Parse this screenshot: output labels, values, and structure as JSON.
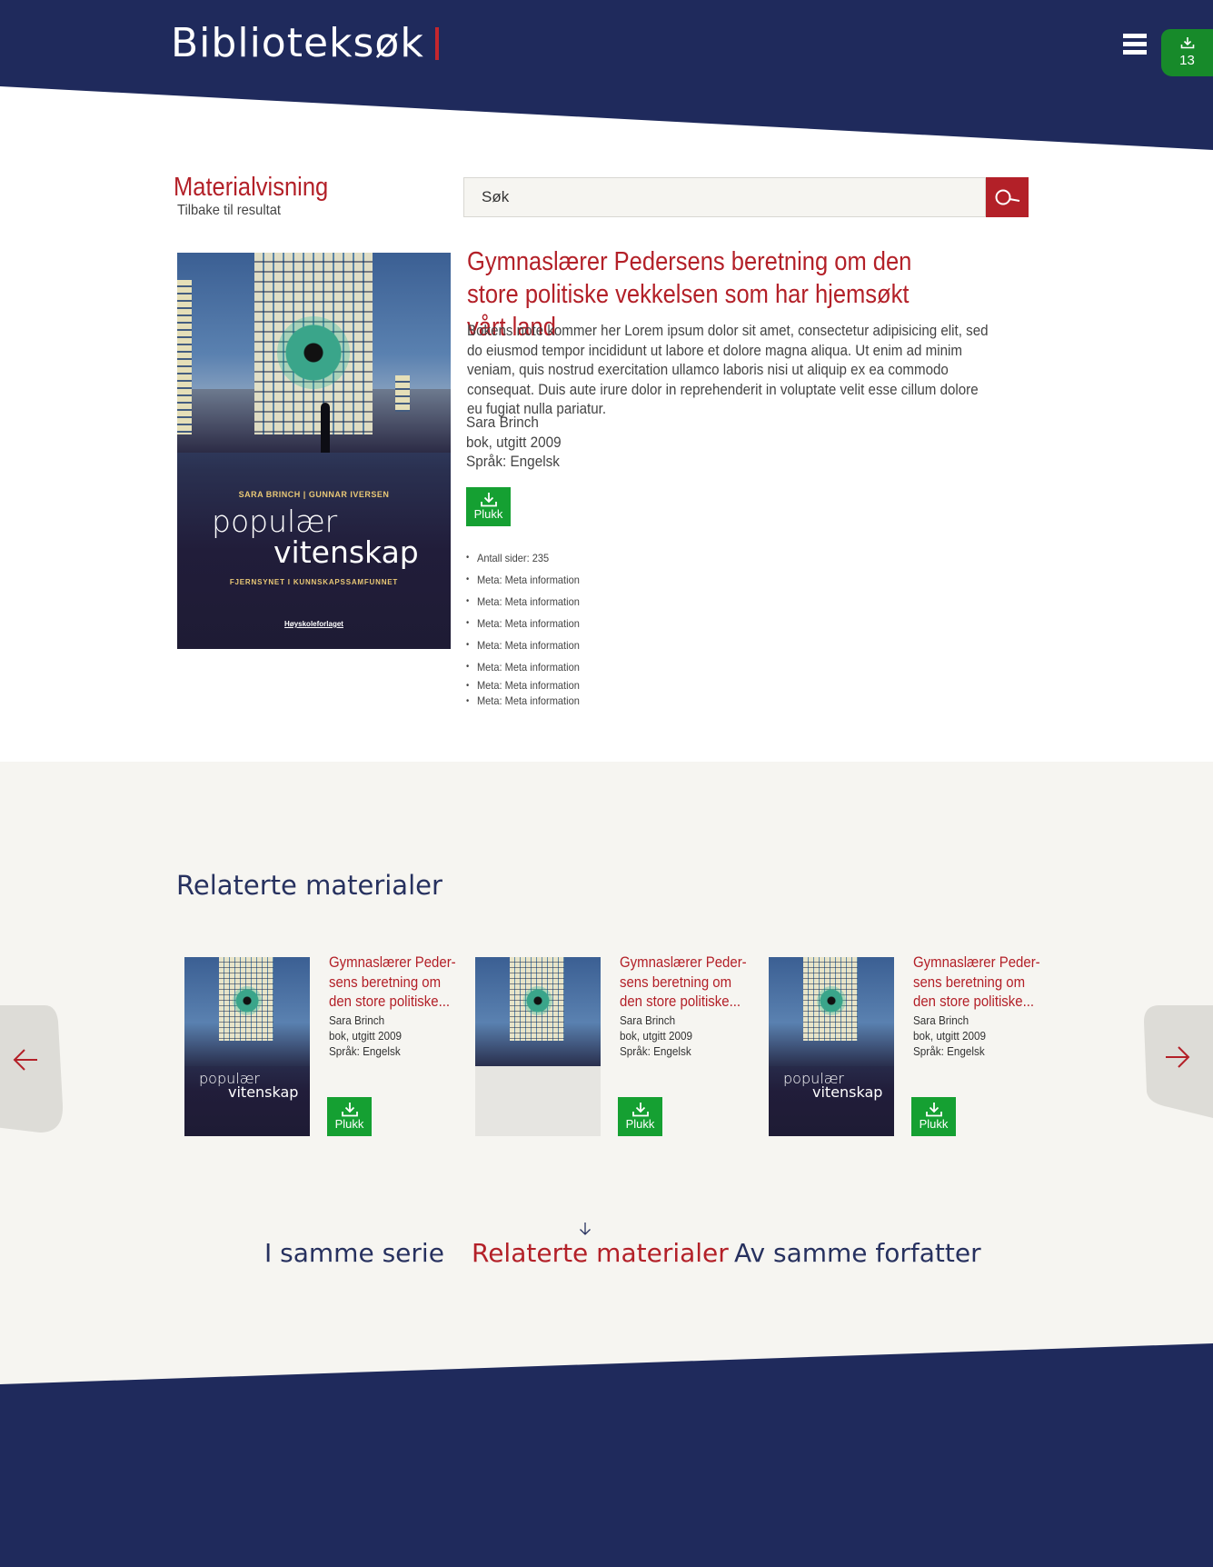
{
  "header": {
    "logo": "Biblioteksøk",
    "pick_count": "13"
  },
  "page": {
    "title": "Materialvisning",
    "back_link": "Tilbake til resultat"
  },
  "search": {
    "placeholder": "Søk"
  },
  "book": {
    "title": "Gymnaslærer Pedersens beretning om den store politiske vekkelsen som har hjemsøkt vårt land",
    "description": "Bokens note kommer her Lorem ipsum dolor sit amet, consectetur adipisicing elit, sed do eiusmod tempor incididunt ut labore et dolore magna aliqua. Ut enim ad minim veniam, quis nostrud exercitation ullamco laboris nisi ut aliquip ex ea commodo consequat. Duis aute irure dolor in reprehenderit in voluptate velit esse cillum dolore eu fugiat nulla pariatur.",
    "author": "Sara Brinch",
    "type_year": "bok, utgitt 2009",
    "language": "Språk: Engelsk",
    "pick_label": "Plukk",
    "meta": [
      "Antall sider: 235",
      "Meta: Meta information",
      "Meta: Meta information",
      "Meta: Meta information",
      "Meta: Meta information",
      "Meta: Meta information",
      "Meta: Meta information",
      "Meta: Meta information"
    ],
    "cover": {
      "authors": "SARA BRINCH | GUNNAR IVERSEN",
      "title_line1": "populær",
      "title_line2": "vitenskap",
      "subtitle": "FJERNSYNET I KUNNSKAPSSAMFUNNET",
      "publisher": "Høyskoleforlaget"
    }
  },
  "related": {
    "heading": "Relaterte materialer",
    "items": [
      {
        "title": "Gymnaslærer Peder-sens beretning om den store politiske...",
        "author": "Sara Brinch",
        "type_year": "bok, utgitt 2009",
        "language": "Språk: Engelsk",
        "pick_label": "Plukk",
        "cover_line1": "populær",
        "cover_line2": "vitenskap"
      },
      {
        "title": "Gymnaslærer Peder-sens beretning om den store politiske...",
        "author": "Sara Brinch",
        "type_year": "bok, utgitt 2009",
        "language": "Språk: Engelsk",
        "pick_label": "Plukk"
      },
      {
        "title": "Gymnaslærer Peder-sens beretning om den store politiske...",
        "author": "Sara Brinch",
        "type_year": "bok, utgitt 2009",
        "language": "Språk: Engelsk",
        "pick_label": "Plukk",
        "cover_line1": "populær",
        "cover_line2": "vitenskap"
      }
    ]
  },
  "tabs": {
    "series": "I samme serie",
    "related": "Relaterte materialer",
    "author": "Av samme forfatter"
  },
  "colors": {
    "navy": "#1f2a5c",
    "red": "#b32028",
    "green": "#15a032",
    "light_bg": "#f6f5f1"
  }
}
